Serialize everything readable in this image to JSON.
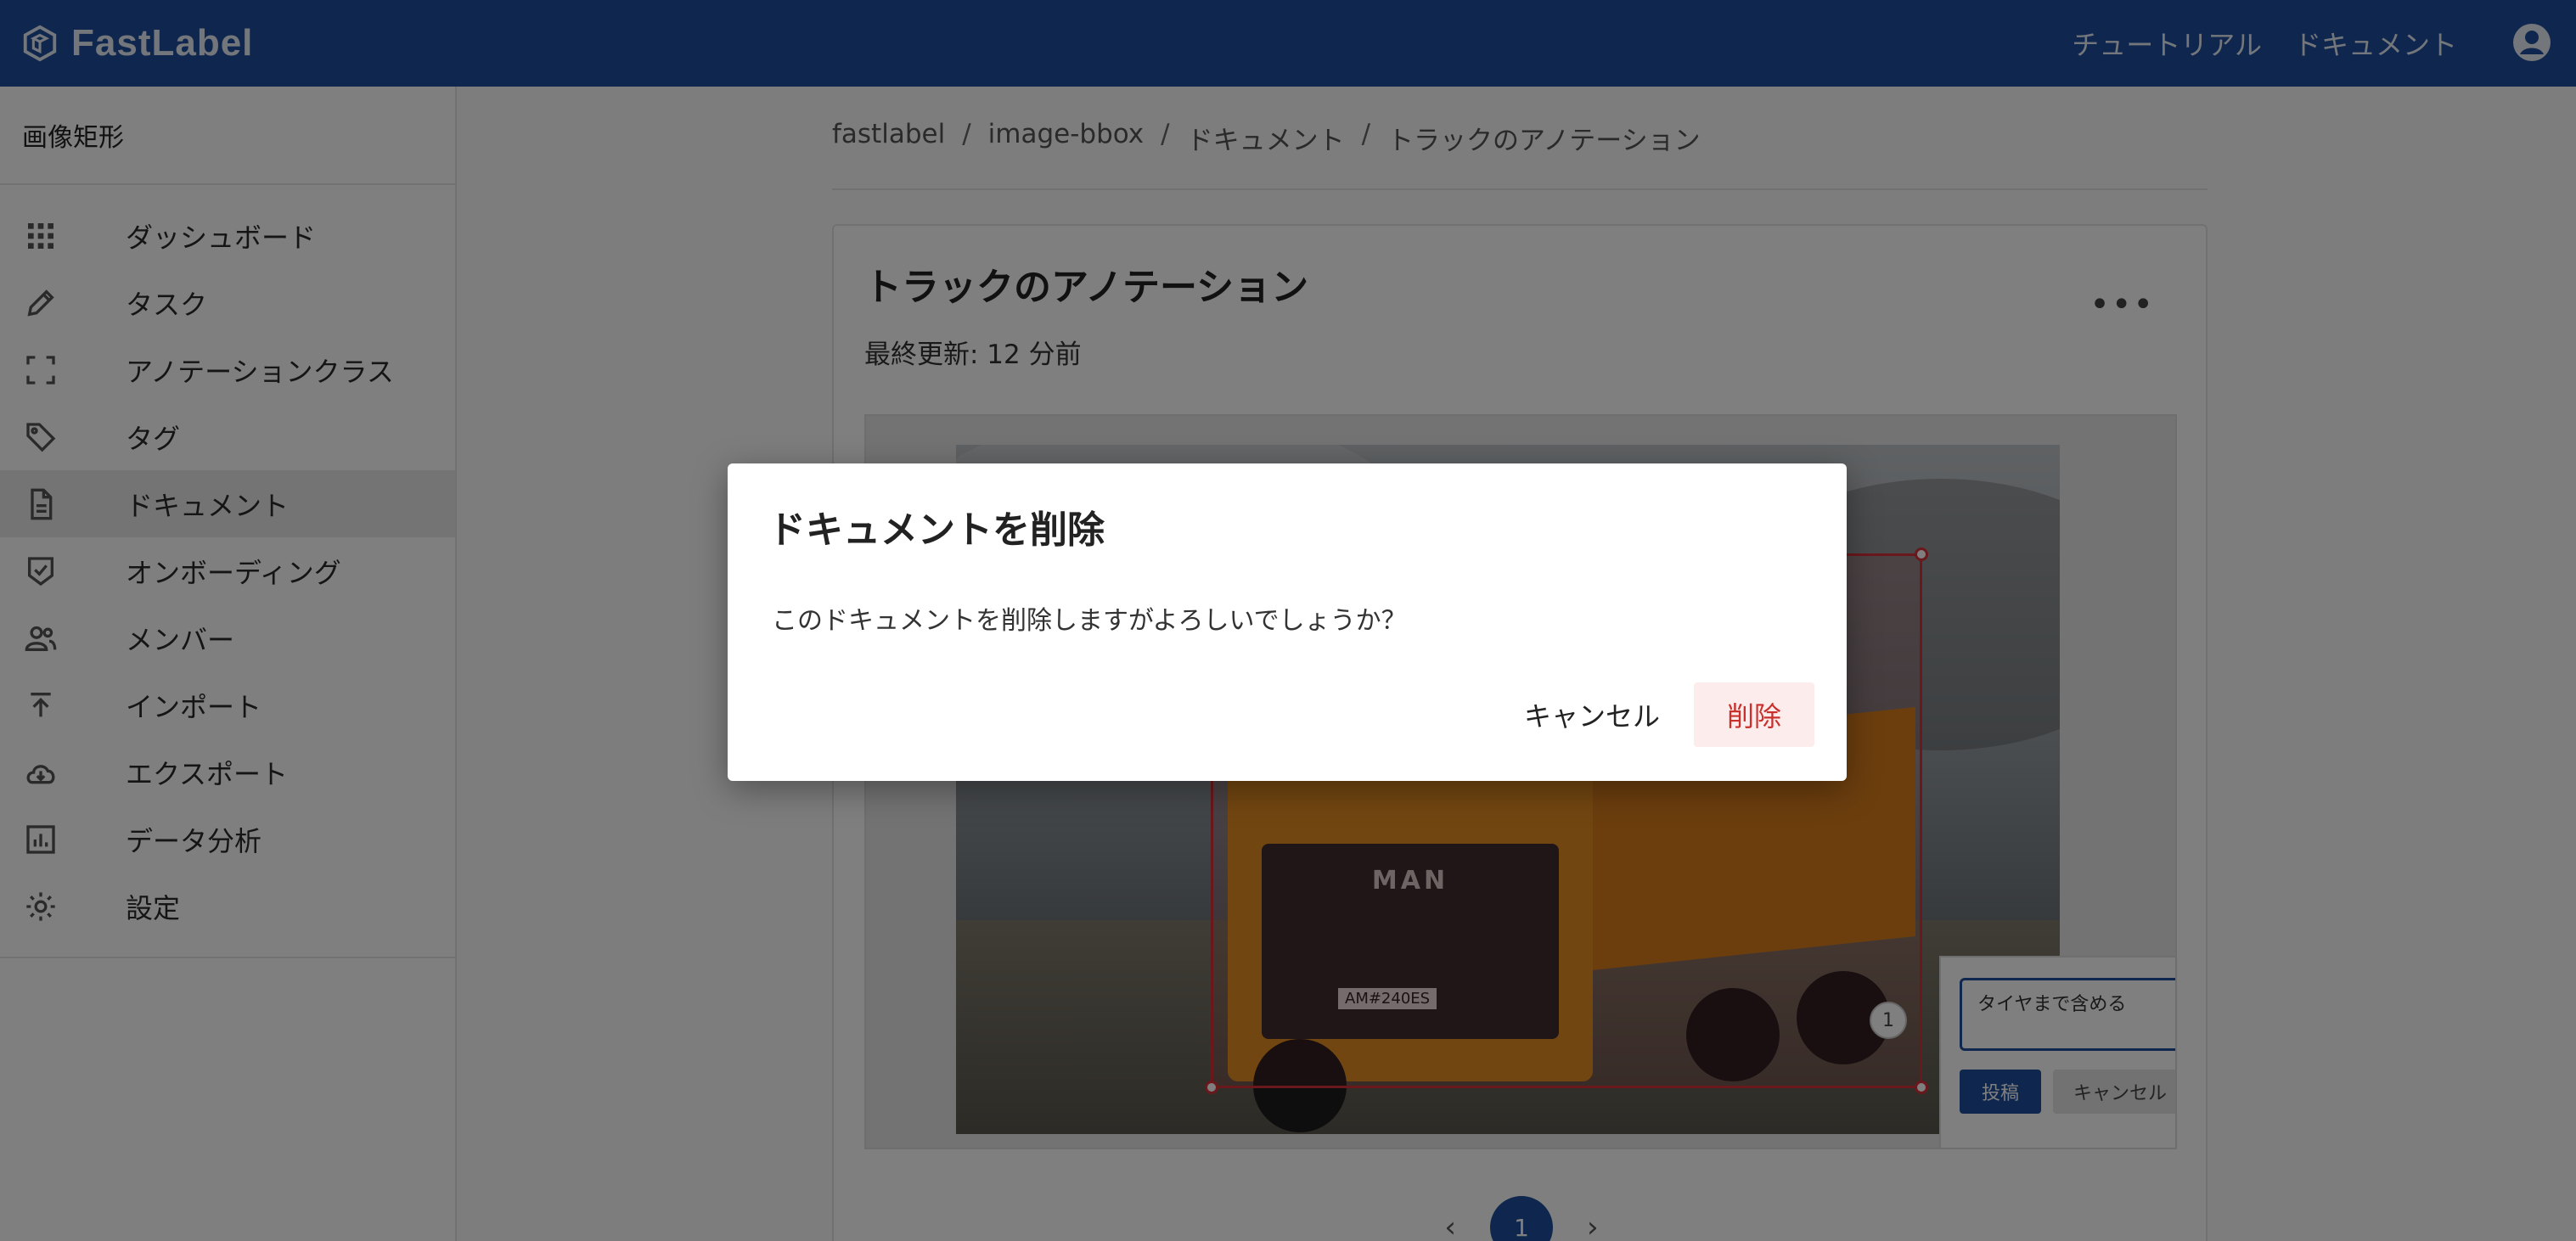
{
  "app": {
    "brand": "FastLabel",
    "topnav": [
      "チュートリアル",
      "ドキュメント"
    ],
    "brand_color": "#1f4e9c"
  },
  "sidebar": {
    "project_title": "画像矩形",
    "items": [
      {
        "label": "ダッシュボード",
        "icon": "grid-icon"
      },
      {
        "label": "タスク",
        "icon": "pencil-icon"
      },
      {
        "label": "アノテーションクラス",
        "icon": "frame-icon"
      },
      {
        "label": "タグ",
        "icon": "tag-icon"
      },
      {
        "label": "ドキュメント",
        "icon": "document-icon",
        "active": true
      },
      {
        "label": "オンボーディング",
        "icon": "shield-check-icon"
      },
      {
        "label": "メンバー",
        "icon": "people-icon"
      },
      {
        "label": "インポート",
        "icon": "upload-icon"
      },
      {
        "label": "エクスポート",
        "icon": "cloud-download-icon"
      },
      {
        "label": "データ分析",
        "icon": "chart-icon"
      },
      {
        "label": "設定",
        "icon": "gear-icon"
      }
    ]
  },
  "breadcrumb": [
    "fastlabel",
    "image-bbox",
    "ドキュメント",
    "トラックのアノテーション"
  ],
  "document": {
    "title": "トラックのアノテーション",
    "updated": "最終更新: 12 分前",
    "more_label": "•••",
    "pin_number": "1",
    "comment": {
      "value": "タイヤまで含める",
      "post_label": "投稿",
      "cancel_label": "キャンセル"
    },
    "pager": {
      "current": "1",
      "prev": "‹",
      "next": "›"
    },
    "image_text": {
      "logo": "MAN",
      "plate": "AM#240ES"
    }
  },
  "dialog": {
    "title": "ドキュメントを削除",
    "message": "このドキュメントを削除しますがよろしいでしょうか？",
    "cancel_label": "キャンセル",
    "delete_label": "削除",
    "delete_color": "#c9302c"
  }
}
